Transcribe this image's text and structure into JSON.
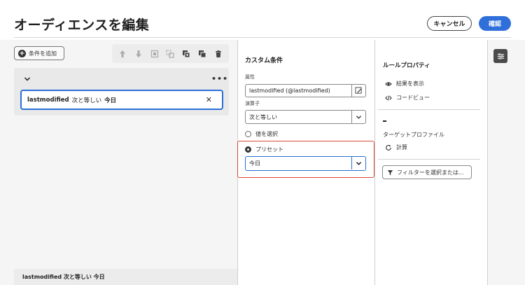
{
  "header": {
    "title": "オーディエンスを編集",
    "cancel_label": "キャンセル",
    "confirm_label": "確認"
  },
  "left_panel": {
    "add_condition_label": "条件を追加",
    "condition": {
      "field": "lastmodified",
      "operator": "次と等しい",
      "value": "今日"
    },
    "footer_summary": "lastmodified 次と等しい 今日"
  },
  "custom_condition": {
    "title": "カスタム条件",
    "attribute_label": "属性",
    "attribute_value": "lastmodified (@lastmodified)",
    "operator_label": "演算子",
    "operator_value": "次と等しい",
    "radio_select_value": "値を選択",
    "radio_preset": "プリセット",
    "preset_value": "今日"
  },
  "rule_properties": {
    "title": "ルールプロパティ",
    "show_results": "結果を表示",
    "code_view": "コードビュー",
    "count_value": "-",
    "target_profile": "ターゲットプロファイル",
    "calculate": "計算",
    "filter_button": "フィルターを選択または..."
  },
  "icons": [
    "plus-circle-icon",
    "arrow-up-icon",
    "arrow-down-icon",
    "group-icon",
    "ungroup-icon",
    "duplicate-icon",
    "copy-icon",
    "trash-icon",
    "chevron-down-icon",
    "more-icon",
    "close-icon",
    "edit-icon",
    "eye-icon",
    "code-icon",
    "refresh-icon",
    "filter-icon",
    "settings-icon"
  ],
  "colors": {
    "accent": "#2f6fda",
    "highlight_border": "#d84a3a"
  }
}
